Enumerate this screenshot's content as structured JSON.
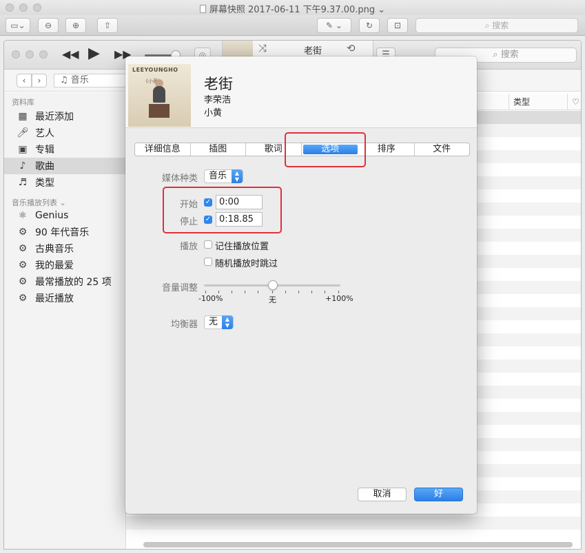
{
  "preview": {
    "title": "屏幕快照 2017-06-11 下午9.37.00.png",
    "search_placeholder": "搜索"
  },
  "itunes": {
    "now_playing_title": "老街",
    "search_placeholder": "搜索",
    "breadcrumb": "音乐",
    "column_type": "类型",
    "sidebar": {
      "library_header": "资料库",
      "library_items": [
        {
          "label": "最近添加",
          "icon": "calendar-icon"
        },
        {
          "label": "艺人",
          "icon": "microphone-icon"
        },
        {
          "label": "专辑",
          "icon": "album-icon"
        },
        {
          "label": "歌曲",
          "icon": "music-note-icon"
        },
        {
          "label": "类型",
          "icon": "genre-icon"
        }
      ],
      "playlists_header": "音乐播放列表",
      "playlist_items": [
        {
          "label": "Genius",
          "icon": "genius-atom-icon"
        },
        {
          "label": "90 年代音乐",
          "icon": "smart-playlist-gear-icon"
        },
        {
          "label": "古典音乐",
          "icon": "smart-playlist-gear-icon"
        },
        {
          "label": "我的最爱",
          "icon": "smart-playlist-gear-icon"
        },
        {
          "label": "最常播放的 25 项",
          "icon": "smart-playlist-gear-icon"
        },
        {
          "label": "最近播放",
          "icon": "smart-playlist-gear-icon"
        }
      ]
    }
  },
  "dialog": {
    "song_title": "老街",
    "artist": "李荣浩",
    "album": "小黄",
    "artwork_text": "LEEYOUNGHO",
    "artwork_sub": "《小黄》",
    "tabs": [
      "详细信息",
      "插图",
      "歌词",
      "选项",
      "排序",
      "文件"
    ],
    "active_tab": "选项",
    "media_kind_label": "媒体种类",
    "media_kind_value": "音乐",
    "start_label": "开始",
    "start_value": "0:00",
    "stop_label": "停止",
    "stop_value": "0:18.85",
    "playback_label": "播放",
    "remember_position": "记住播放位置",
    "skip_shuffle": "随机播放时跳过",
    "volume_label": "音量调整",
    "volume_min": "-100%",
    "volume_mid": "无",
    "volume_max": "+100%",
    "volume_adjust": 0,
    "eq_label": "均衡器",
    "eq_value": "无",
    "cancel": "取消",
    "ok": "好"
  },
  "colors": {
    "accent_blue": "#2a7fe8",
    "annotation_red": "#e0303a"
  }
}
